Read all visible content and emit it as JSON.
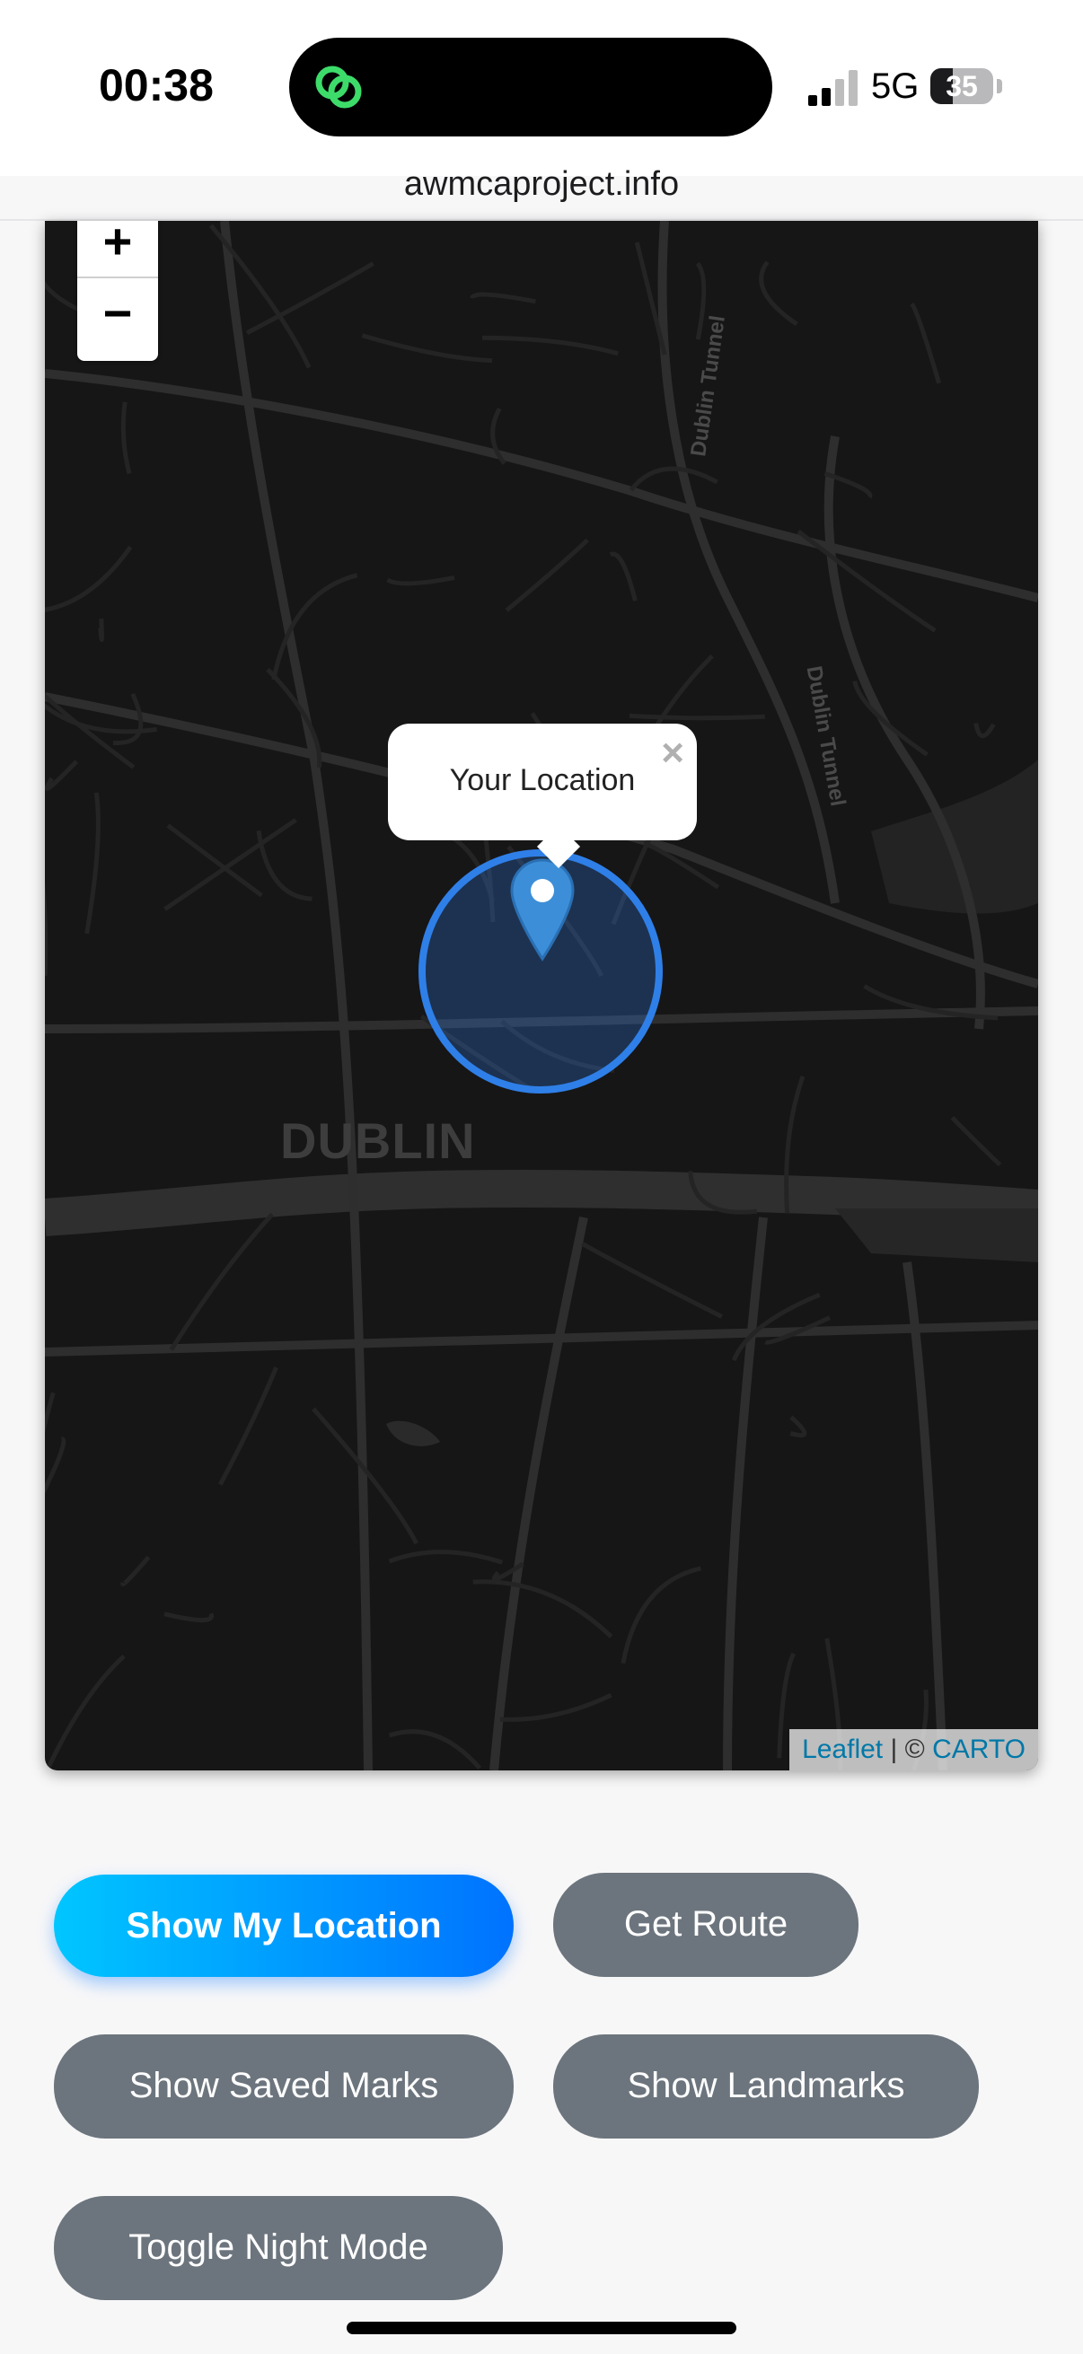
{
  "status_bar": {
    "time": "00:38",
    "network": "5G",
    "battery": "35",
    "battery_level": 0.35
  },
  "browser": {
    "url": "awmcaproject.info"
  },
  "map": {
    "zoom_in_label": "+",
    "zoom_out_label": "−",
    "city_label": "DUBLIN",
    "tunnel_label_1": "Dublin Tunnel",
    "tunnel_label_2": "Dublin Tunnel",
    "popup_text": "Your Location",
    "popup_close": "×",
    "attribution": {
      "leaflet": "Leaflet",
      "separator": "|",
      "copyright": "©",
      "carto": "CARTO"
    },
    "colors": {
      "background": "#161616",
      "roads": "#2c2c2c",
      "water": "#2f2f2f",
      "location_circle": "#2f7fe8",
      "marker": "#3c8ed8"
    }
  },
  "buttons": {
    "show_my_location": "Show My Location",
    "get_route": "Get Route",
    "show_saved_marks": "Show Saved Marks",
    "show_landmarks": "Show Landmarks",
    "toggle_night_mode": "Toggle Night Mode"
  }
}
